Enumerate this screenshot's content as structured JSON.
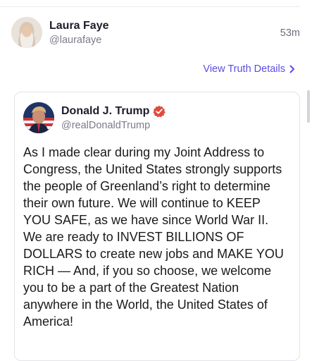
{
  "post": {
    "author_name": "Laura Faye",
    "author_handle": "@laurafaye",
    "time": "53m",
    "avatar_icon": "user-avatar"
  },
  "actions": {
    "view_details_label": "View Truth Details",
    "view_details_icon": "chevron-right-icon"
  },
  "quoted": {
    "author_name": "Donald J. Trump",
    "author_handle": "@realDonaldTrump",
    "verified_icon": "verified-badge-icon",
    "body": "As I made clear during my Joint Address to Congress, the United States strongly supports the people of Greenland’s right to determine their own future. We will continue to KEEP YOU SAFE, as we have since World War II. We are ready to INVEST BILLIONS OF DOLLARS to create new jobs and MAKE YOU RICH — And, if you so choose, we welcome you to be a part of the Greatest Nation anywhere in the World, the United States of America!"
  },
  "colors": {
    "accent": "#5b4ee0",
    "verified": "#e04b3a",
    "muted_text": "#7b7b8c"
  }
}
